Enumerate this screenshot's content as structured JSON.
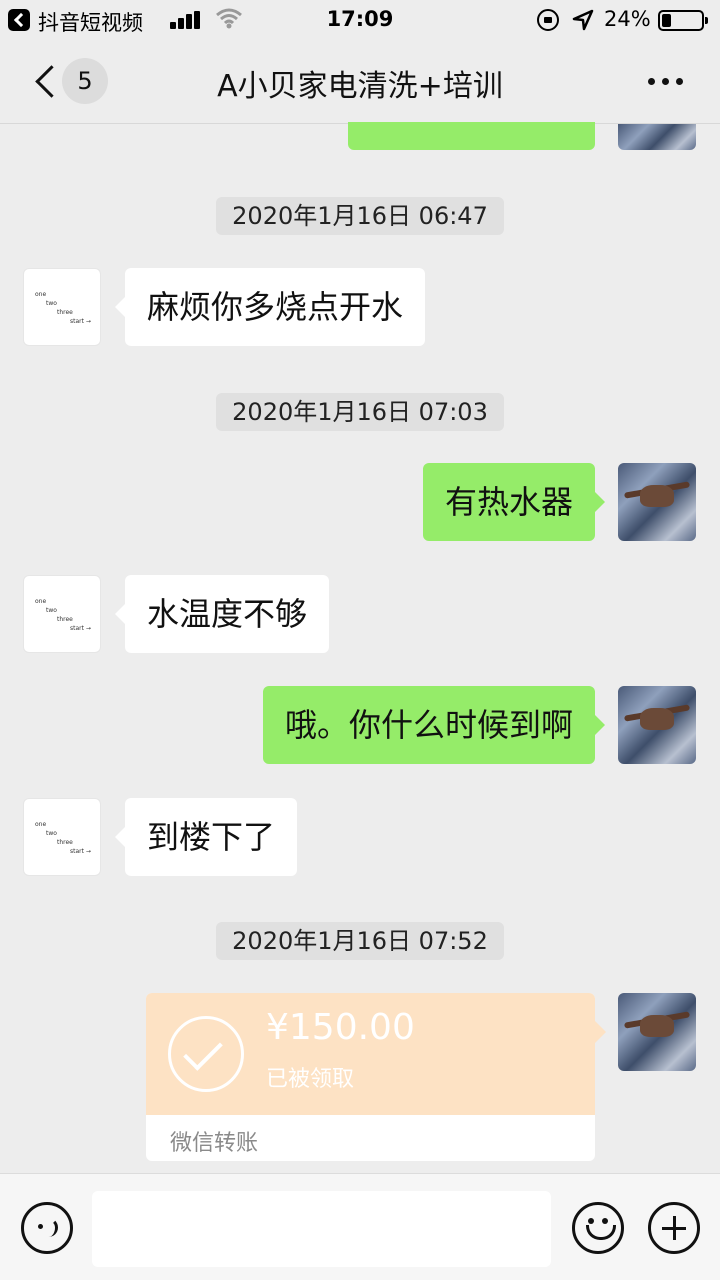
{
  "status_bar": {
    "back_app": "抖音短视频",
    "time": "17:09",
    "battery": "24%"
  },
  "nav": {
    "unread_count": "5",
    "title": "A小贝家电清洗+培训"
  },
  "avatar_left_text": {
    "one": "one",
    "two": "two",
    "three": "three",
    "start": "start →"
  },
  "messages": {
    "t1": "2020年1月16日 06:47",
    "m1": "麻烦你多烧点开水",
    "t2": "2020年1月16日 07:03",
    "m2": "有热水器",
    "m3": "水温度不够",
    "m4": "哦。你什么时候到啊",
    "m5": "到楼下了",
    "t3": "2020年1月16日 07:52"
  },
  "transfer": {
    "amount": "¥150.00",
    "status": "已被领取",
    "footer": "微信转账"
  },
  "colors": {
    "self_bubble": "#95ec69",
    "other_bubble": "#ffffff",
    "transfer_bg": "#fde2c4",
    "chat_bg": "#ededed"
  }
}
